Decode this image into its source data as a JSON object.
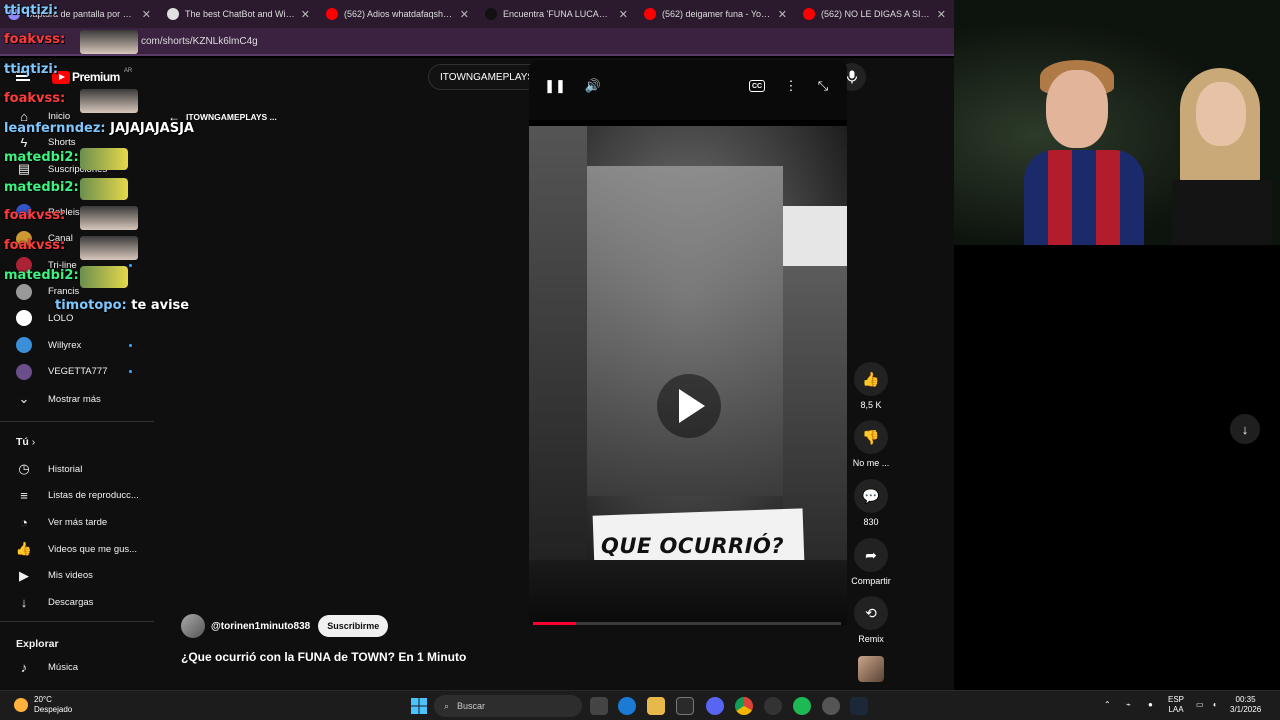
{
  "browser": {
    "tabs": [
      {
        "title": "Captura de pantalla por Lightsh",
        "color": "#8c8cff"
      },
      {
        "title": "The best ChatBot and Widgets",
        "color": "#e0e0e0"
      },
      {
        "title": "(562) Adios whatdafaqshow Ep",
        "color": "#ff0000"
      },
      {
        "title": "Encuentra 'FUNA LUCAS CASTE",
        "color": "#111111"
      },
      {
        "title": "(562) deigamer funa - YouTube",
        "color": "#ff0000"
      },
      {
        "title": "(562) NO LE DIGAS A SIRI QUE",
        "color": "#ff0000"
      }
    ],
    "url": "com/shorts/KZNLk6lmC4g"
  },
  "youtube": {
    "logo_text": "Premium",
    "logo_region": "AR",
    "search_query": "ITOWNGAMEPLAYS FUNA",
    "back_label": "ITOWNGAMEPLAYS ...",
    "sidebar": {
      "main": [
        {
          "label": "Inicio",
          "icon": "home-icon"
        },
        {
          "label": "Shorts",
          "icon": "shorts-icon"
        },
        {
          "label": "Suscripciones",
          "icon": "subscriptions-icon"
        }
      ],
      "subscriptions": [
        {
          "label": "Robleis",
          "color": "#3355cc",
          "dot": false
        },
        {
          "label": "Canal",
          "color": "#cc9933",
          "dot": false
        },
        {
          "label": "Tri-line",
          "color": "#aa2233",
          "dot": true
        },
        {
          "label": "Francis",
          "color": "#999999",
          "dot": false
        },
        {
          "label": "LOLO",
          "color": "#ffffff",
          "dot": false
        },
        {
          "label": "Willyrex",
          "color": "#3a8fd8",
          "dot": true
        },
        {
          "label": "VEGETTA777",
          "color": "#6b4e8a",
          "dot": true
        }
      ],
      "show_more": "Mostrar más",
      "you_heading": "Tú",
      "you": [
        {
          "label": "Historial",
          "icon": "history-icon"
        },
        {
          "label": "Listas de reproducc...",
          "icon": "playlists-icon"
        },
        {
          "label": "Ver más tarde",
          "icon": "watch-later-icon"
        },
        {
          "label": "Videos que me gus...",
          "icon": "liked-icon"
        },
        {
          "label": "Mis videos",
          "icon": "my-videos-icon"
        },
        {
          "label": "Descargas",
          "icon": "downloads-icon"
        }
      ],
      "explore_heading": "Explorar",
      "explore": [
        {
          "label": "Música",
          "icon": "music-icon"
        }
      ]
    },
    "short": {
      "overlay_text": "QUE OCURRIÓ?",
      "progress": 0.14,
      "channel": "@torinen1minuto838",
      "subscribe": "Suscribirme",
      "title": "¿Que ocurrió con la FUNA de TOWN? En 1 Minuto"
    },
    "actions": {
      "likes": "8,5 K",
      "dislike": "No me ...",
      "comments": "830",
      "share": "Compartir",
      "remix": "Remix"
    }
  },
  "chat": [
    {
      "user": "ttiqtizi:",
      "msg": "",
      "cls": "b"
    },
    {
      "user": "foakvss:",
      "msg": "",
      "cls": ""
    },
    {
      "user": "ttiqtizi:",
      "msg": "",
      "cls": "b"
    },
    {
      "user": "foakvss:",
      "msg": "",
      "cls": ""
    },
    {
      "user": "leanfernndez:",
      "msg": "JAJAJAJASJA",
      "cls": "b"
    },
    {
      "user": "matedbi2:",
      "msg": "",
      "cls": "g"
    },
    {
      "user": "matedbi2:",
      "msg": "",
      "cls": "g"
    },
    {
      "user": "foakvss:",
      "msg": "",
      "cls": ""
    },
    {
      "user": "foakvss:",
      "msg": "",
      "cls": ""
    },
    {
      "user": "matedbi2:",
      "msg": "",
      "cls": "g"
    },
    {
      "user": "timotopo:",
      "msg": "te avise",
      "cls": "b"
    }
  ],
  "taskbar": {
    "temp": "20°C",
    "weather": "Despejado",
    "search": "Buscar",
    "lang1": "ESP",
    "lang2": "LAA",
    "time": "00:35",
    "date": "3/1/2026"
  }
}
